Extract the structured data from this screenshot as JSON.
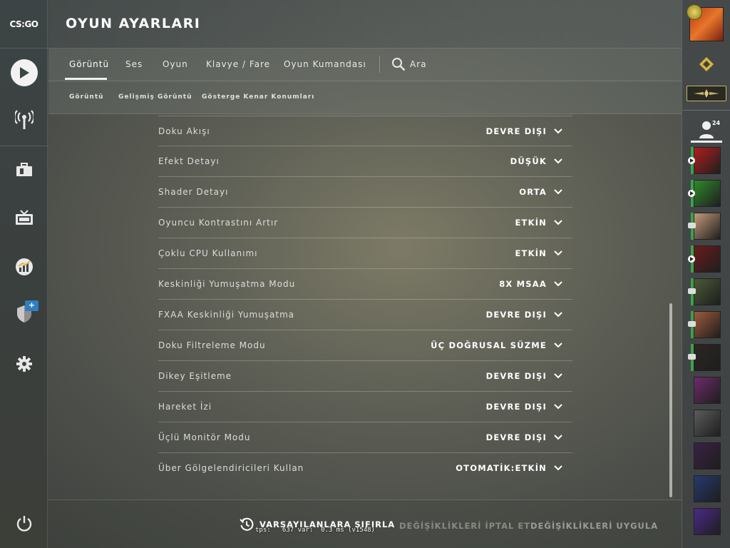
{
  "app": {
    "logo_text": "CS:GO"
  },
  "header": {
    "title": "OYUN AYARLARI"
  },
  "tabs": [
    {
      "label": "Görüntü",
      "active": true
    },
    {
      "label": "Ses"
    },
    {
      "label": "Oyun"
    },
    {
      "label": "Klavye / Fare"
    },
    {
      "label": "Oyun Kumandası"
    }
  ],
  "search": {
    "label": "Ara"
  },
  "subtabs": [
    {
      "label": "Görüntü"
    },
    {
      "label": "Gelişmiş Görüntü"
    },
    {
      "label": "Gösterge Kenar Konumları"
    }
  ],
  "settings": [
    {
      "label": "Doku Akışı",
      "value": "DEVRE DIŞI"
    },
    {
      "label": "Efekt Detayı",
      "value": "DÜŞÜK"
    },
    {
      "label": "Shader Detayı",
      "value": "ORTA"
    },
    {
      "label": "Oyuncu Kontrastını Artır",
      "value": "ETKİN"
    },
    {
      "label": "Çoklu CPU Kullanımı",
      "value": "ETKİN"
    },
    {
      "label": "Keskinliği Yumuşatma Modu",
      "value": "8X MSAA"
    },
    {
      "label": "FXAA Keskinliği Yumuşatma",
      "value": "DEVRE DIŞI"
    },
    {
      "label": "Doku Filtreleme Modu",
      "value": "ÜÇ DOĞRUSAL SÜZME"
    },
    {
      "label": "Dikey Eşitleme",
      "value": "DEVRE DIŞI"
    },
    {
      "label": "Hareket İzi",
      "value": "DEVRE DIŞI"
    },
    {
      "label": "Üçlü Monitör Modu",
      "value": "DEVRE DIŞI"
    },
    {
      "label": "Über Gölgelendiricileri Kullan",
      "value": "OTOMATİK:ETKİN"
    }
  ],
  "bottom": {
    "reset_label": "VARSAYILANLARA SIFIRLA",
    "cancel_label": "DEĞİŞİKLİKLERİ İPTAL ET",
    "apply_label": "DEĞİŞİKLİKLERİ UYGULA",
    "fps_text": "tps:   637 var:  0.3 ms (v1548)"
  },
  "friends": {
    "count": "24",
    "list": [
      {
        "status": "play",
        "color": "#b31d1d"
      },
      {
        "status": "play",
        "color": "#2f8a2b"
      },
      {
        "status": "desk",
        "color": "#c49b7a"
      },
      {
        "status": "play",
        "color": "#6b1c1c"
      },
      {
        "status": "desk",
        "color": "#4b5a37"
      },
      {
        "status": "desk",
        "color": "#a05a3c"
      },
      {
        "status": "desk",
        "color": "#2d2622"
      },
      {
        "status": "none",
        "color": "#6e2b6b"
      },
      {
        "status": "none",
        "color": "#5c5c5c"
      },
      {
        "status": "none",
        "color": "#3a2245"
      },
      {
        "status": "none",
        "color": "#263a6e"
      },
      {
        "status": "none",
        "color": "#4a2a88"
      }
    ]
  },
  "colors": {
    "accent": "#f0f0f0",
    "online": "#3aa24a",
    "badge": "#2f7ec0"
  }
}
